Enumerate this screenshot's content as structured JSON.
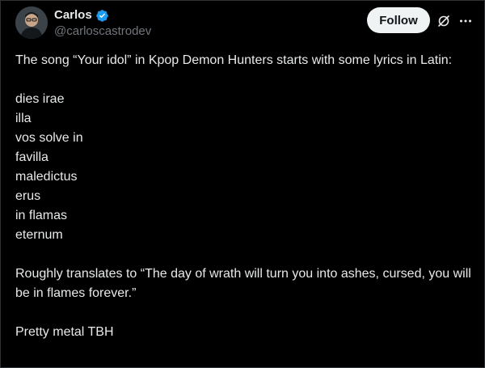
{
  "author": {
    "display_name": "Carlos",
    "handle": "@carloscastrodev",
    "verified": true
  },
  "actions": {
    "follow_label": "Follow",
    "grok_icon": "grok-icon",
    "more_icon": "more-icon"
  },
  "post": {
    "intro": "The song “Your idol” in Kpop Demon Hunters starts with some lyrics in Latin:",
    "lyrics": [
      "dies irae",
      "illa",
      "vos solve in",
      "favilla",
      "maledictus",
      "erus",
      "in flamas",
      "eternum"
    ],
    "translation": "Roughly translates to “The day of wrath will turn you into ashes, cursed, you will be in flames forever.”",
    "closing": "Pretty metal TBH"
  },
  "colors": {
    "background": "#000000",
    "text": "#e7e9ea",
    "muted": "#71767b",
    "verified_blue": "#1d9bf0",
    "follow_bg": "#eff3f4"
  }
}
